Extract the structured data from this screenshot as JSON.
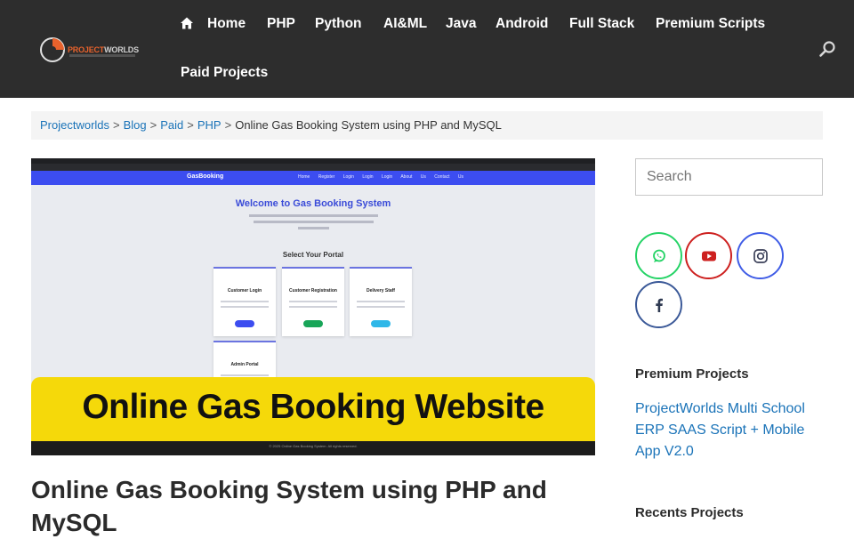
{
  "header": {
    "logo": {
      "brand": "PROJECTWORLDS"
    },
    "nav": [
      {
        "label": "Home"
      },
      {
        "label": "PHP"
      },
      {
        "label": "Python"
      },
      {
        "label": "AI&ML"
      },
      {
        "label": "Java"
      },
      {
        "label": "Android"
      },
      {
        "label": "Full Stack"
      },
      {
        "label": "Premium Scripts"
      },
      {
        "label": "Paid Projects"
      }
    ],
    "search_icon": "search-icon"
  },
  "breadcrumb": {
    "items": [
      "Projectworlds",
      "Blog",
      "Paid",
      "PHP"
    ],
    "current": "Online Gas Booking System using PHP and MySQL",
    "separator": ">"
  },
  "featured_image": {
    "app_brand": "GasBooking",
    "app_nav": "Home Register Login Login Login About Us Contact Us",
    "welcome": "Welcome to Gas Booking System",
    "portal_heading": "Select Your Portal",
    "cards": [
      {
        "title": "Customer Login"
      },
      {
        "title": "Customer Registration"
      },
      {
        "title": "Delivery Staff"
      },
      {
        "title": "Admin Portal"
      }
    ],
    "banner": "Online Gas Booking Website",
    "footer": "© 2025 Online Gas Booking System. All rights reserved."
  },
  "post": {
    "title": "Online Gas Booking System using PHP and MySQL"
  },
  "sidebar": {
    "search_placeholder": "Search",
    "social": [
      {
        "icon": "whatsapp-icon",
        "color": "#25d366"
      },
      {
        "icon": "youtube-icon",
        "color": "#cd201f"
      },
      {
        "icon": "instagram-icon",
        "color": "#405de6"
      },
      {
        "icon": "facebook-icon",
        "color": "#3b5998"
      }
    ],
    "premium_heading": "Premium Projects",
    "premium_link": "ProjectWorlds Multi School ERP SAAS Script + Mobile App V2.0",
    "recent_heading": "Recents Projects"
  },
  "colors": {
    "header_bg": "#2d2d2d",
    "link": "#1a73b8",
    "banner": "#f5d90a"
  }
}
